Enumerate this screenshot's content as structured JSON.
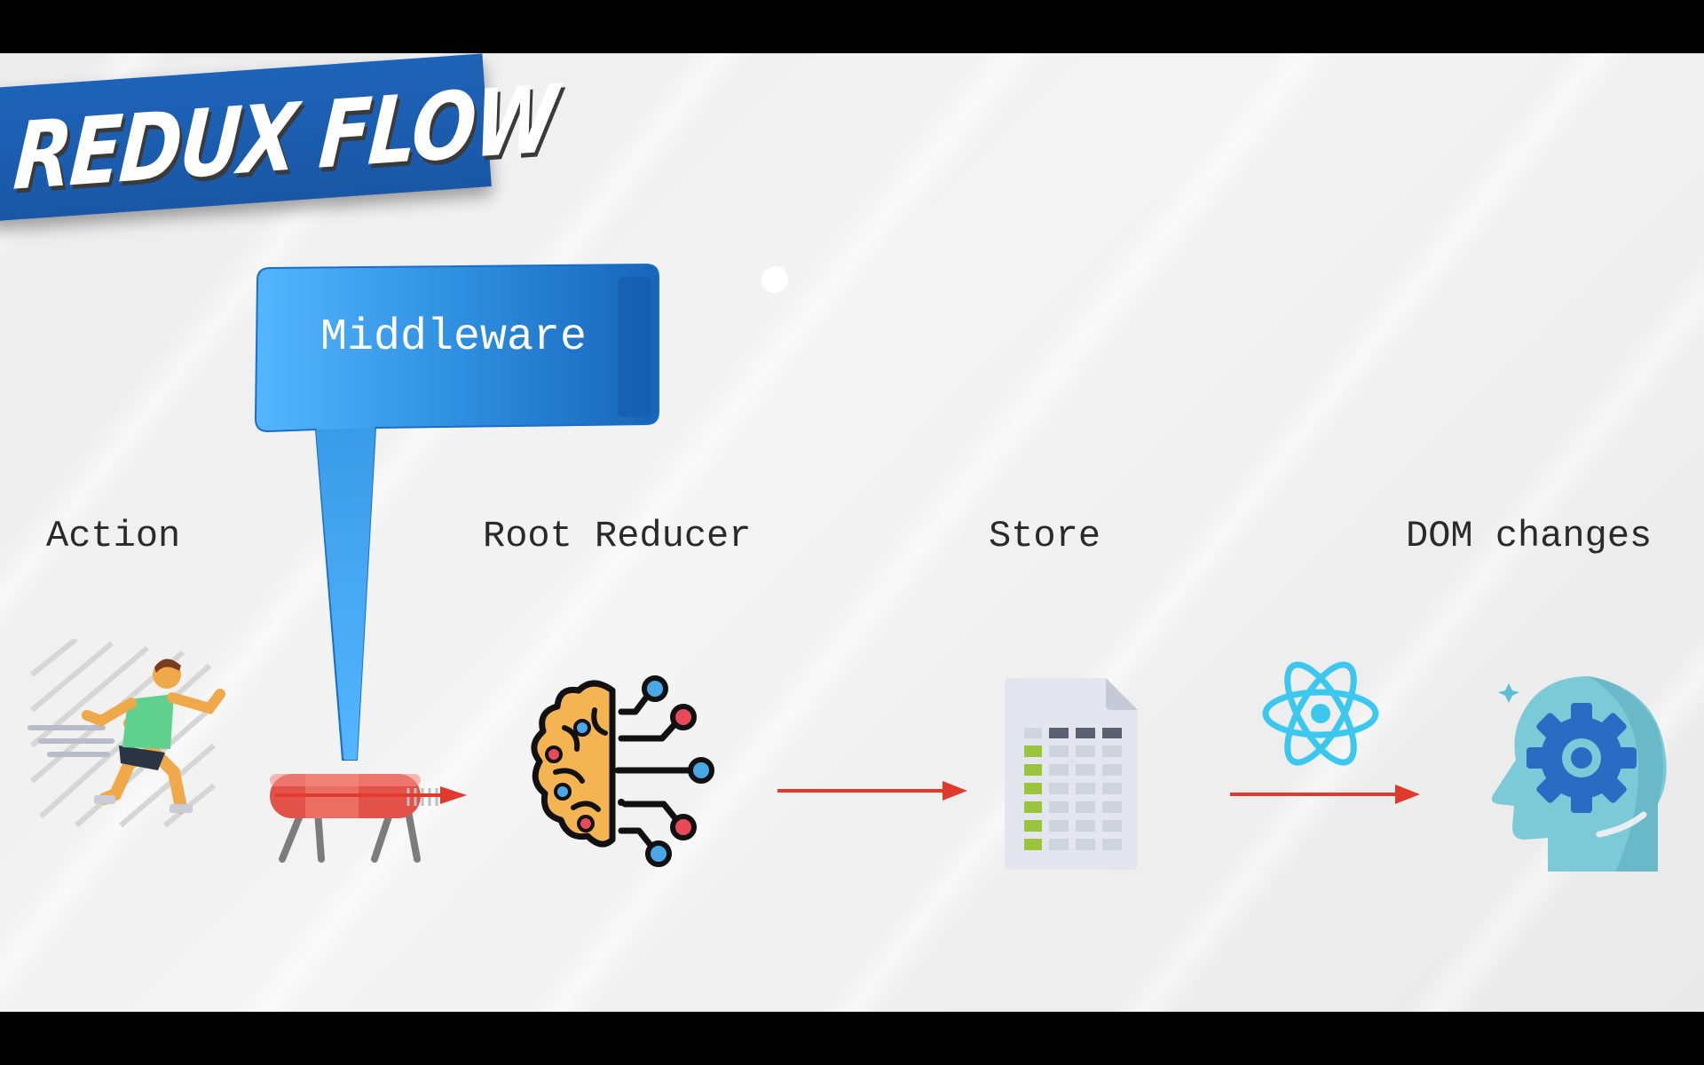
{
  "title": "REDUX FLOW",
  "callout": {
    "label": "Middleware"
  },
  "stages": [
    {
      "label": "Action",
      "icon": "runner-icon"
    },
    {
      "label": "Root Reducer",
      "icon": "brain-circuit-icon"
    },
    {
      "label": "Store",
      "icon": "spreadsheet-document-icon"
    },
    {
      "label": "DOM changes",
      "icon": "head-gear-icon"
    }
  ],
  "colors": {
    "banner": "#1e63b8",
    "callout": "#2f8fe0",
    "arrow": "#e03a2e",
    "react": "#3cc7ef"
  },
  "icons": [
    "vaulting-horse-icon",
    "react-logo-icon"
  ]
}
